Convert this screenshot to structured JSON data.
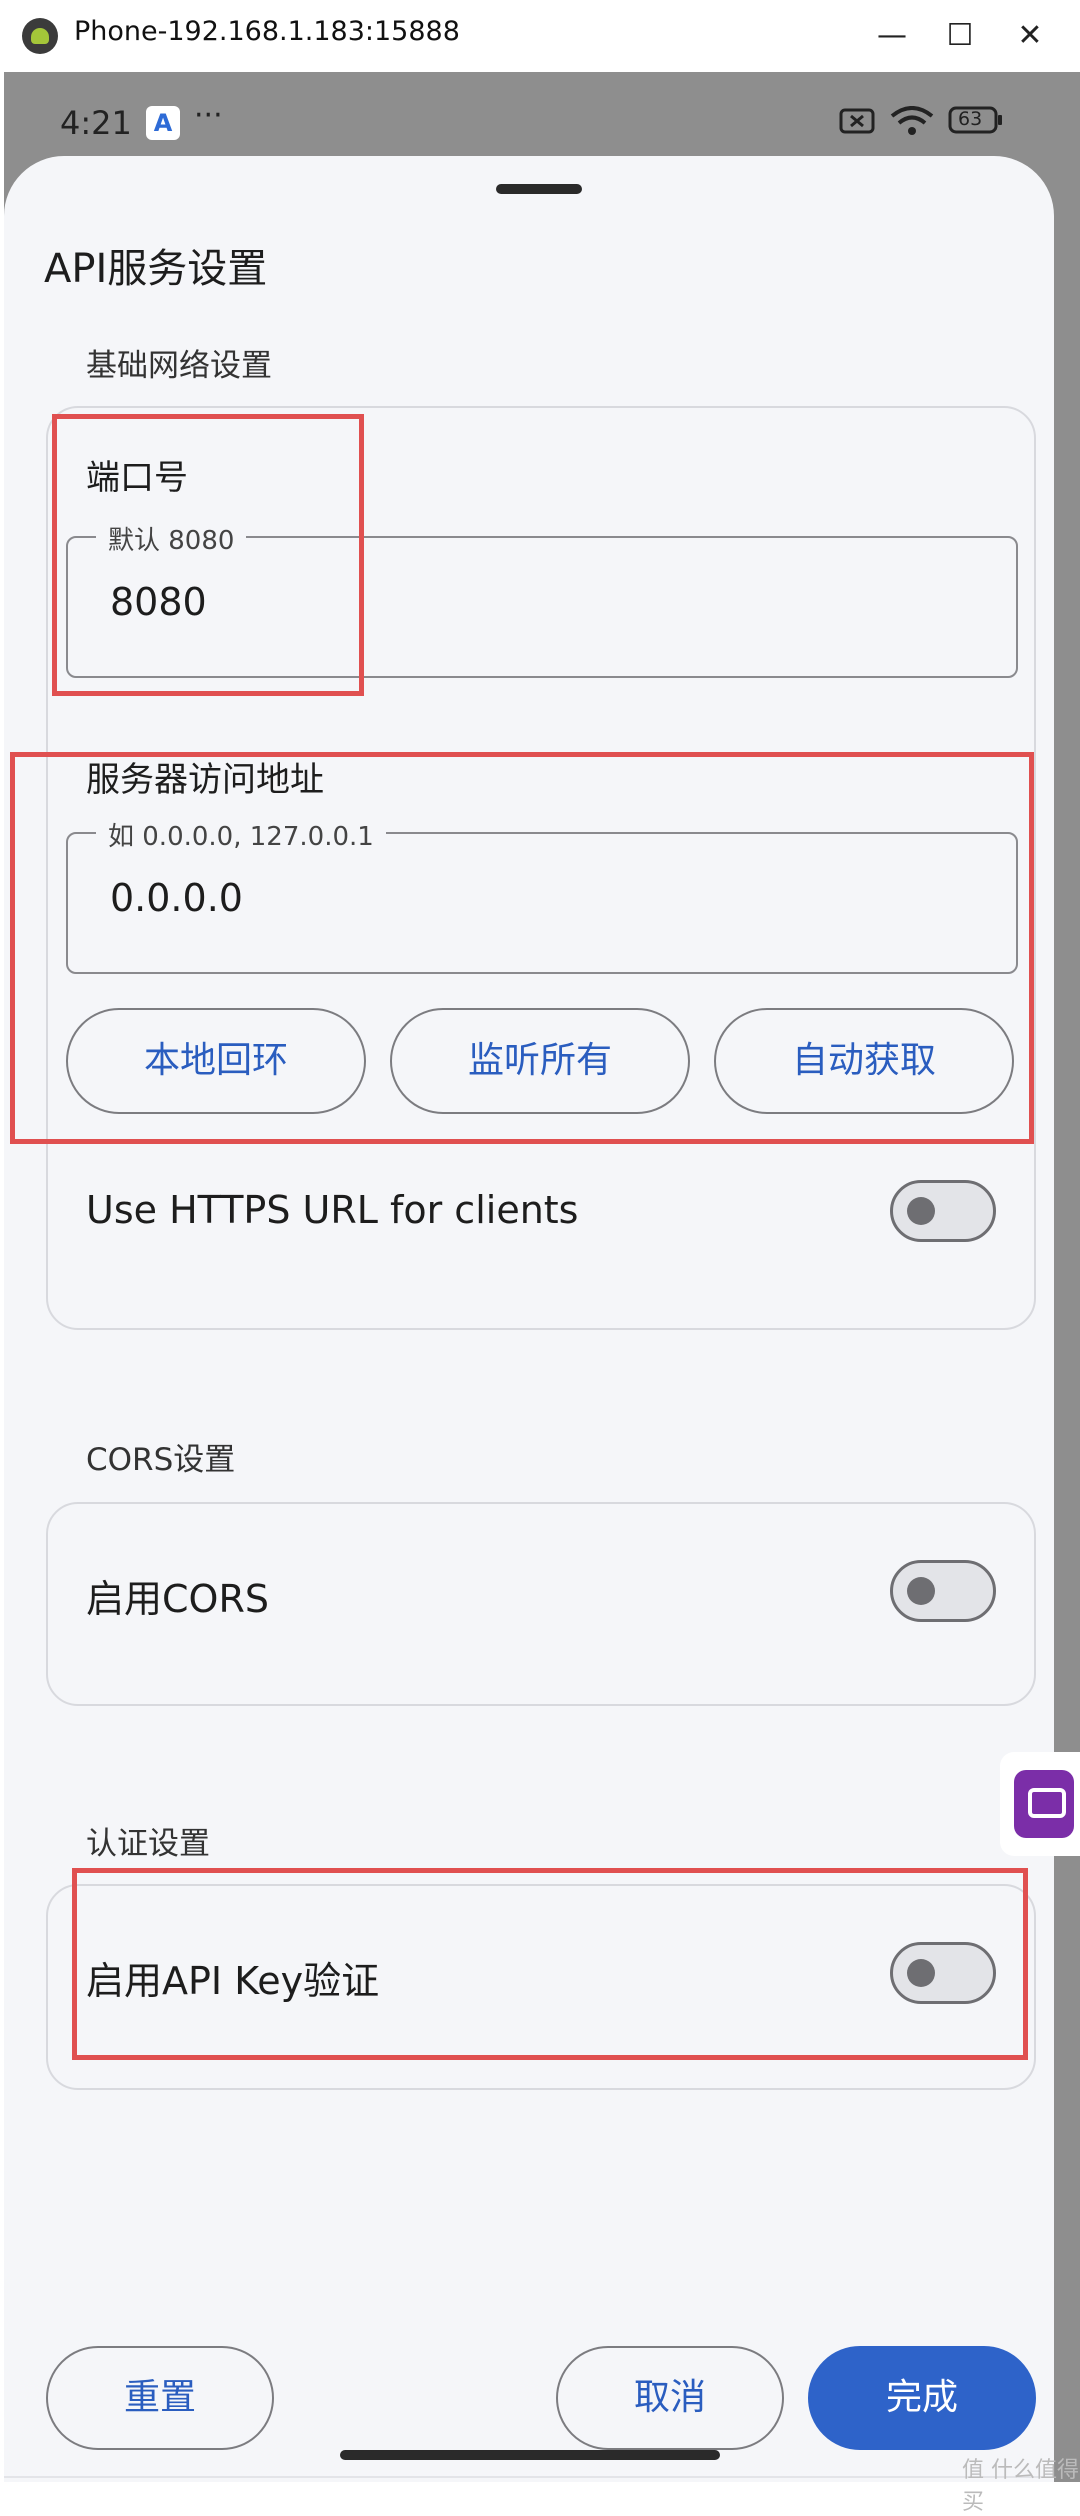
{
  "window": {
    "title": "Phone-192.168.1.183:15888",
    "minimize_glyph": "—",
    "maximize_glyph": "☐",
    "close_glyph": "✕"
  },
  "status_bar": {
    "time": "4:21",
    "app_badge": "A",
    "more": "···",
    "battery": "63"
  },
  "sheet": {
    "title": "API服务设置"
  },
  "network": {
    "section_label": "基础网络设置",
    "port_label": "端口号",
    "port_placeholder": "默认 8080",
    "port_value": "8080",
    "address_label": "服务器访问地址",
    "address_placeholder": "如 0.0.0.0, 127.0.0.1",
    "address_value": "0.0.0.0",
    "chips": [
      "本地回环",
      "监听所有",
      "自动获取"
    ],
    "https_label": "Use HTTPS URL for clients",
    "https_enabled": false
  },
  "cors": {
    "section_label": "CORS设置",
    "enable_label": "启用CORS",
    "enabled": false
  },
  "auth": {
    "section_label": "认证设置",
    "api_key_label": "启用API Key验证",
    "enabled": false
  },
  "footer": {
    "reset": "重置",
    "cancel": "取消",
    "done": "完成"
  },
  "watermark": "值 什么值得买",
  "colors": {
    "accent": "#2e63c9",
    "highlight_box": "#e05050"
  }
}
